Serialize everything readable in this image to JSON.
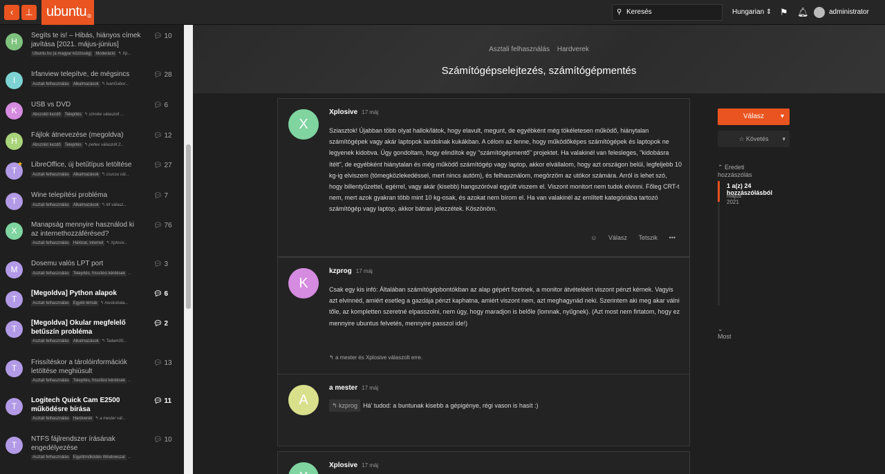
{
  "topbar": {
    "logo": "ubuntu",
    "logo_mark": "®",
    "search_placeholder": "Keresés",
    "language": "Hungarian ⇕",
    "username": "administrator"
  },
  "sidebar": {
    "topics": [
      {
        "letter": "H",
        "color": "#7ec27e",
        "title": "Segíts te is! – Hibás, hiányos címek javítása [2021. május-június]",
        "tags": [
          "Ubuntu.hu (a magyar közösség)",
          "Moderáció"
        ],
        "extra": "↰ Xp...",
        "count": "10",
        "bold": false
      },
      {
        "letter": "I",
        "color": "#7dd3d3",
        "title": "Irfanview telepítve, de mégsincs",
        "tags": [
          "Asztali felhasználás",
          "Alkalmazások"
        ],
        "extra": "↰ IvanGabor...",
        "count": "28",
        "bold": false
      },
      {
        "letter": "K",
        "color": "#d58be0",
        "title": "USB vs DVD",
        "tags": [
          "Abszolút kezdő",
          "Telepítés"
        ],
        "extra": "↰ sömike válaszolt ...",
        "count": "6",
        "bold": false
      },
      {
        "letter": "H",
        "color": "#a9d47a",
        "title": "Fájlok átnevezése (megoldva)",
        "tags": [
          "Abszolút kezdő",
          "Telepítés"
        ],
        "extra": "↰ petlex válaszolt 2...",
        "count": "12",
        "bold": false
      },
      {
        "letter": "T",
        "color": "#b39ae6",
        "title": "LibreOffice, új betűtípus letöltése",
        "tags": [
          "Asztali felhasználás",
          "Alkalmazások"
        ],
        "extra": "↰ csucsu vál...",
        "count": "27",
        "bold": false
      },
      {
        "letter": "T",
        "color": "#b39ae6",
        "title": "Wine telepítési probléma",
        "tags": [
          "Asztali felhasználás",
          "Alkalmazások"
        ],
        "extra": "↰ klt válasz...",
        "count": "7",
        "bold": false
      },
      {
        "letter": "X",
        "color": "#7fd4a0",
        "title": "Manapság mennyire használod ki az internethozzáférésed?",
        "tags": [
          "Asztali felhasználás",
          "Hálózat, internet"
        ],
        "extra": "↰ Xplosiv...",
        "count": "76",
        "bold": false
      },
      {
        "letter": "M",
        "color": "#b39ae6",
        "title": "Dosemu valós LPT port",
        "tags": [
          "Asztali felhasználás",
          "Telepítés, frissítési kérdések"
        ],
        "extra": "...",
        "count": "3",
        "bold": false
      },
      {
        "letter": "T",
        "color": "#b39ae6",
        "title": "[Megoldva] Python alapok",
        "tags": [
          "Asztali felhasználás",
          "Egyéb témák"
        ],
        "extra": "↰ meskobala...",
        "count": "6",
        "bold": true
      },
      {
        "letter": "T",
        "color": "#b39ae6",
        "title": "[Megoldva] Okular megfelelő betűszín probléma",
        "tags": [
          "Asztali felhasználás",
          "Alkalmazások"
        ],
        "extra": "↰ Tadam00...",
        "count": "2",
        "bold": true
      },
      {
        "letter": "T",
        "color": "#b39ae6",
        "title": "Frissítéskor a tárolóinformációk letöltése meghiúsult",
        "tags": [
          "Asztali felhasználás",
          "Telepítés, frissítési kérdések"
        ],
        "extra": "...",
        "count": "13",
        "bold": false
      },
      {
        "letter": "T",
        "color": "#b39ae6",
        "title": "Logitech Quick Cam E2500 működésre bírása",
        "tags": [
          "Asztali felhasználás",
          "Hardverek"
        ],
        "extra": "↰ a mester vál...",
        "count": "11",
        "bold": true
      },
      {
        "letter": "T",
        "color": "#b39ae6",
        "title": "NTFS fájlrendszer írásának engedélyezése",
        "tags": [
          "Asztali felhasználás",
          "Együttműködés Windowszal"
        ],
        "extra": "...",
        "count": "10",
        "bold": false
      }
    ]
  },
  "main": {
    "breadcrumb": [
      "Asztali felhasználás",
      "Hardverek"
    ],
    "title": "Számítógépselejtezés, számítógépmentés",
    "posts": [
      {
        "letter": "X",
        "color": "#7fd4a0",
        "author": "Xplosive",
        "date": "17 máj",
        "body": "Sziasztok! Újabban több olyat hallok/látok, hogy elavult, megunt, de egyébként még tökéletesen működő, hiánytalan számítógépek vagy akár laptopok landolnak kukákban. A célom az lenne, hogy működőképes számítógépek és laptopok ne legyenek kidobva. Úgy gondoltam, hogy elindítok egy \"számítógépmentő\" projektet. Ha valakinél van felesleges, \"kidobásra ítélt\", de egyébként hiánytalan és még működő számítógép vagy laptop, akkor elvállalom, hogy azt országon belül, legfeljebb 10 kg-ig elviszem (tömegközlekedéssel, mert nincs autóm), és felhasználom, megörzöm az utókor számára. Arról is lehet szó, hogy billentyűzettel, egérrel, vagy akár (kisebb) hangszóróval együtt viszem el. Viszont monitort nem tudok elvinni. Főleg CRT-t nem, mert azok gyakran több mint 10 kg-osak, és azokat nem bírom el. Ha van valakinél az említett kategóriába tartozó számítógép vagy laptop, akkor bátran jelezzétek. Köszönöm.",
        "reply": "Válasz",
        "like": "Tetszik"
      },
      {
        "letter": "K",
        "color": "#d58be0",
        "author": "kzprog",
        "date": "17 máj",
        "body": "Csak egy kis infó: Általában számítógépbontókban az alap gépért fizetnek, a monitor átvételéért viszont pénzt kérnek. Vagyis azt elvinnéd, amiért esetleg a gazdája pénzt kaphatna, amiért viszont nem, azt meghagynád neki. Szerintem aki meg akar válni tőle, az kompletten szeretné elpasszolni, nem úgy, hogy maradjon is belőle (lomnak, nyűgnek). (Azt most nem firtatom, hogy ez mennyire ubuntus felvetés, mennyire passzol ide!)",
        "replied": "a mester és Xplosive válaszolt erre."
      },
      {
        "letter": "A",
        "color": "#d9e08c",
        "author": "a mester",
        "date": "17 máj",
        "quote": "kzprog",
        "body": "Há' tudod: a buntunak kisebb a gépigénye, régi vason is hasít :)"
      },
      {
        "letter": "X",
        "color": "#7fd4a0",
        "author": "Xplosive",
        "date": "17 máj"
      }
    ]
  },
  "right": {
    "reply_label": "Válasz",
    "follow_label": "Követés",
    "original_post": "Eredeti hozzászólás",
    "timeline_label": "1 a(z) 24 hozzászólásból",
    "timeline_date": "május 2021",
    "timeline_progress": 0.04,
    "now_label": "Most"
  }
}
